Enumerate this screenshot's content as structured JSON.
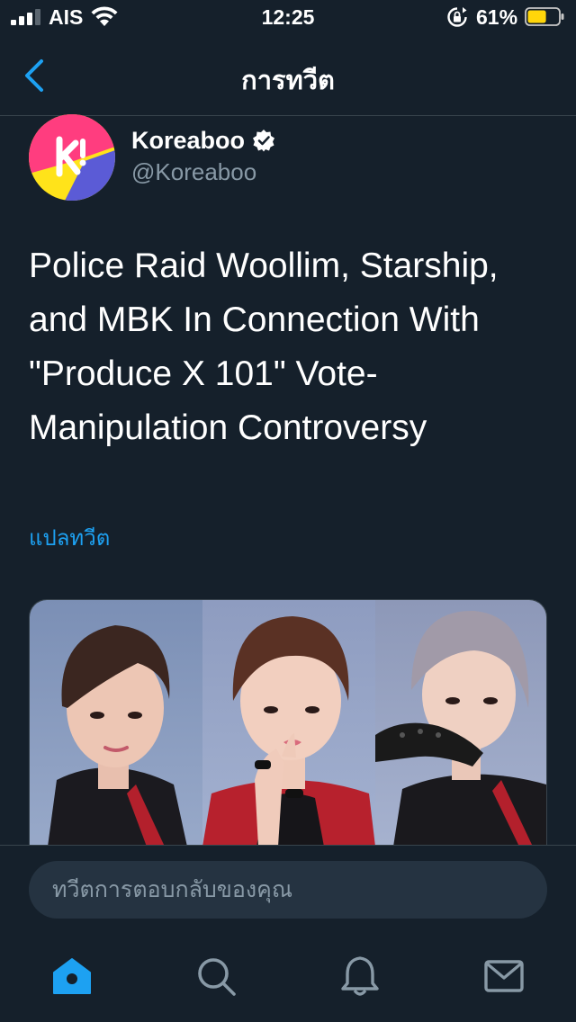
{
  "status_bar": {
    "carrier": "AIS",
    "time": "12:25",
    "battery_percent": "61%",
    "battery_level": 0.61,
    "battery_color": "#ffd60a"
  },
  "header": {
    "title": "การทวีต",
    "back_icon": "chevron-left-icon"
  },
  "tweet": {
    "display_name": "Koreaboo",
    "username": "@Koreaboo",
    "verified": true,
    "text": "Police Raid Woollim, Starship, and MBK In Connection With \"Produce X 101\" Vote-Manipulation Controversy",
    "translate_label": "แปลทวีต",
    "media_count": 3
  },
  "reply": {
    "placeholder": "ทวีตการตอบกลับของคุณ"
  },
  "tab_bar": {
    "items": [
      "home-icon",
      "search-icon",
      "notifications-icon",
      "messages-icon"
    ]
  },
  "colors": {
    "background": "#15202b",
    "accent": "#1da1f2",
    "secondary_text": "#8899a6"
  }
}
